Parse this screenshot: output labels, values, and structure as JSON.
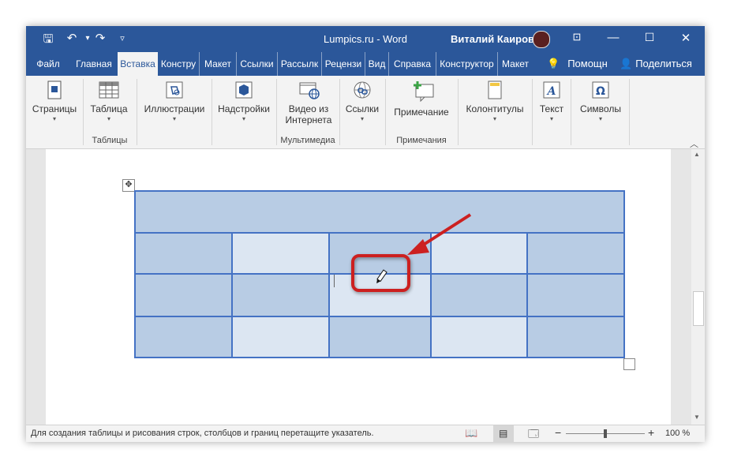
{
  "window": {
    "title": "Lumpics.ru  -  Word",
    "user": "Виталий Каиров",
    "quick_access": [
      "save-icon",
      "undo-icon",
      "redo-icon",
      "customize-icon"
    ],
    "controls": [
      "ribbon-display-icon",
      "minimize-icon",
      "maximize-icon",
      "close-icon"
    ]
  },
  "tabs": [
    "Файл",
    "Главная",
    "Вставка",
    "Констру",
    "Макет",
    "Ссылки",
    "Рассылк",
    "Рецензи",
    "Вид",
    "Справка",
    "Конструктор",
    "Макет"
  ],
  "active_tab": "Вставка",
  "help": "Помощн",
  "share": "Поделиться",
  "ribbon": {
    "pages": "Страницы",
    "table": "Таблица",
    "illustrations": "Иллюстрации",
    "addins": "Надстройки",
    "video_line1": "Видео из",
    "video_line2": "Интернета",
    "links": "Ссылки",
    "comment": "Примечание",
    "headers": "Колонтитулы",
    "text": "Текст",
    "symbols": "Символы",
    "groups": {
      "tables": "Таблицы",
      "multimedia": "Мультимедиа",
      "comments": "Примечания"
    }
  },
  "status": {
    "message": "Для создания таблицы и рисования строк, столбцов и границ перетащите указатель.",
    "zoom": "100 %",
    "zoom_level_percent": 100
  },
  "colors": {
    "accent": "#2b579a",
    "cell_dark": "#b8cce4",
    "cell_light": "#dce6f2",
    "table_border": "#4472c4",
    "annotation": "#cc2020"
  }
}
